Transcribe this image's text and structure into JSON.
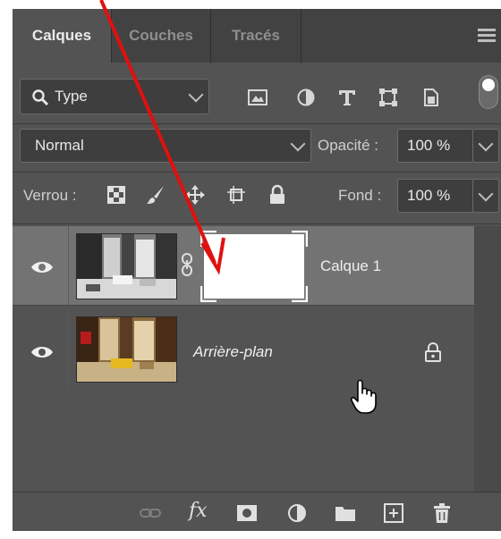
{
  "tabs": [
    {
      "label": "Calques",
      "active": true
    },
    {
      "label": "Couches",
      "active": false
    },
    {
      "label": "Tracés",
      "active": false
    }
  ],
  "filter": {
    "label": "Type"
  },
  "blend": {
    "mode": "Normal",
    "opacity_label": "Opacité :",
    "opacity_value": "100 %"
  },
  "lock": {
    "label": "Verrou :",
    "fill_label": "Fond :",
    "fill_value": "100 %"
  },
  "layers": [
    {
      "name": "Calque 1",
      "selected": true,
      "has_mask": true
    },
    {
      "name": "Arrière-plan",
      "selected": false,
      "locked": true
    }
  ],
  "bottom": {
    "fx_label": "fx"
  },
  "colors": {
    "panel": "#535353",
    "tab_bar": "#424242",
    "selected_layer": "#737373",
    "arrow": "#e01010"
  }
}
